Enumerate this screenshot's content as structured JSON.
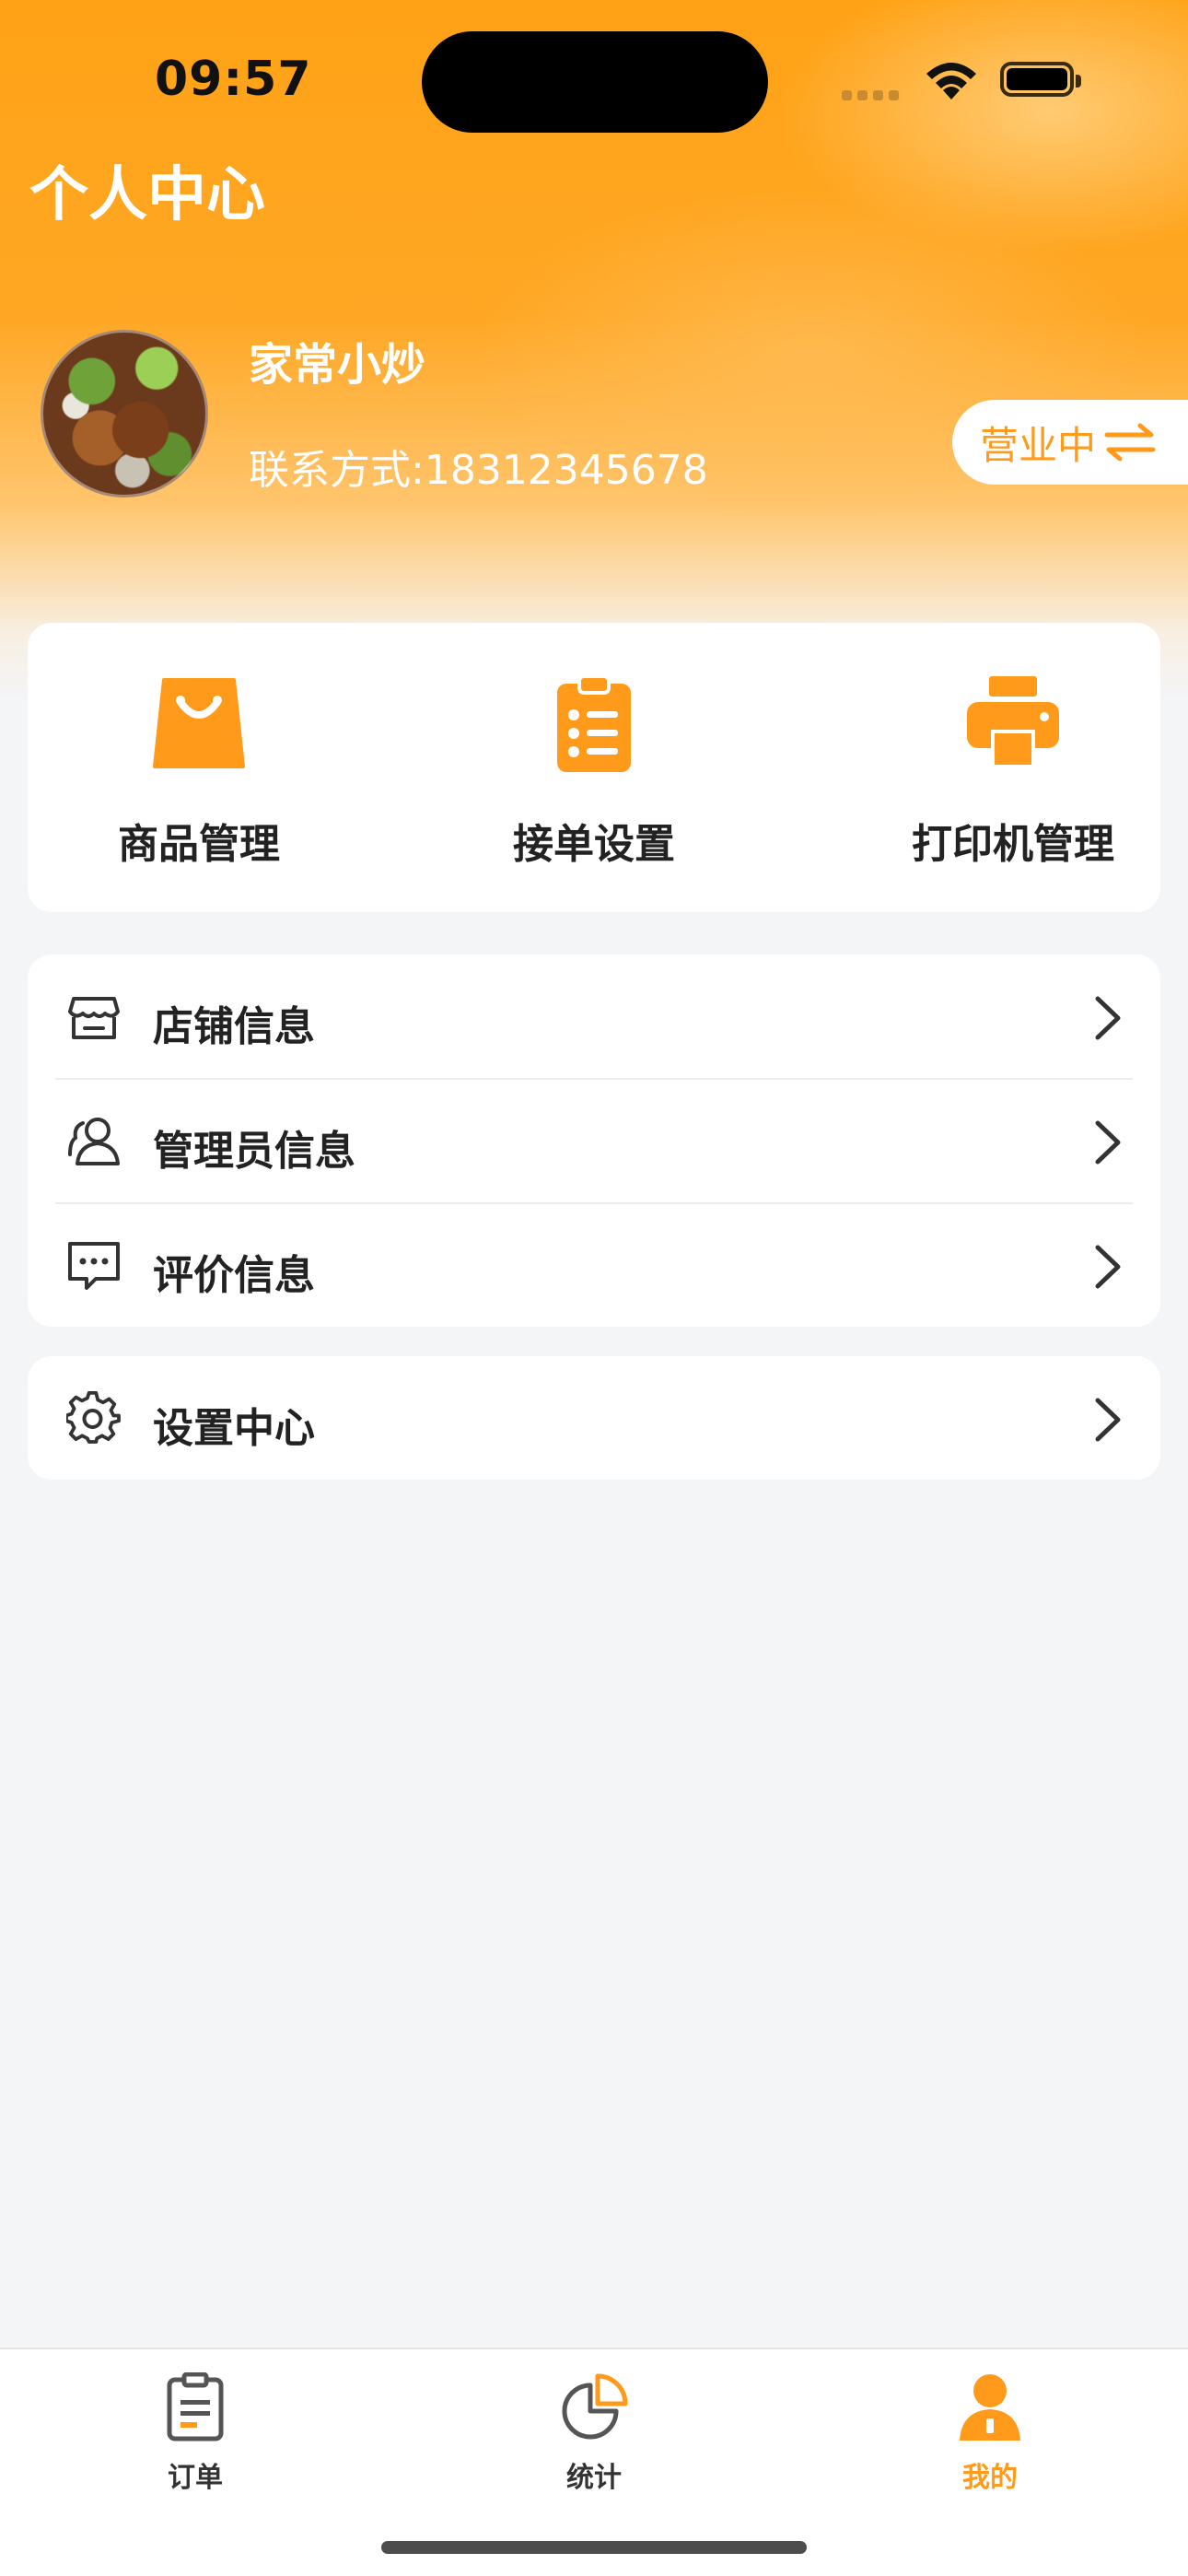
{
  "status_bar": {
    "time": "09:57"
  },
  "header": {
    "title": "个人中心"
  },
  "shop": {
    "name": "家常小炒",
    "contact": "联系方式:18312345678",
    "status": "营业中"
  },
  "quick_actions": [
    {
      "label": "商品管理",
      "icon": "shopping-bag-icon"
    },
    {
      "label": "接单设置",
      "icon": "clipboard-list-icon"
    },
    {
      "label": "打印机管理",
      "icon": "printer-icon"
    }
  ],
  "menu": {
    "items": [
      {
        "label": "店铺信息",
        "icon": "store-icon"
      },
      {
        "label": "管理员信息",
        "icon": "users-icon"
      },
      {
        "label": "评价信息",
        "icon": "message-icon"
      }
    ],
    "settings": {
      "label": "设置中心",
      "icon": "gear-icon"
    }
  },
  "tabbar": {
    "tabs": [
      {
        "label": "订单",
        "icon": "order-clipboard-icon"
      },
      {
        "label": "统计",
        "icon": "pie-chart-icon"
      },
      {
        "label": "我的",
        "icon": "person-icon",
        "active": true
      }
    ]
  },
  "colors": {
    "accent": "#ff9a1a",
    "background": "#f4f5f7"
  }
}
